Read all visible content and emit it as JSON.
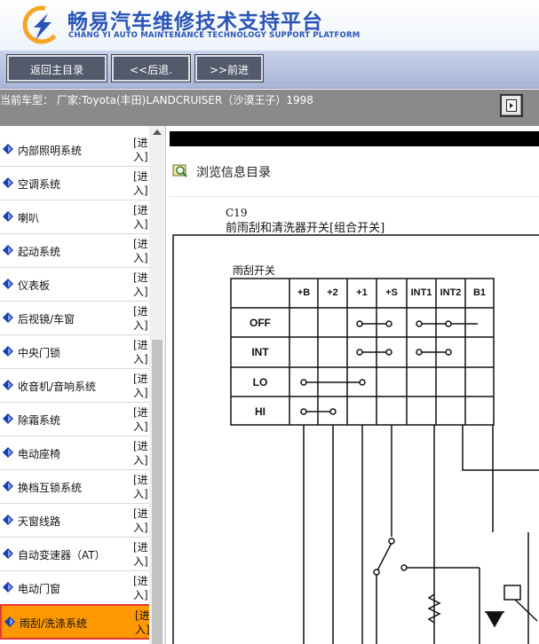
{
  "header": {
    "title_cn": "畅易汽车维修技术支持平台",
    "title_en": "CHANG YI AUTO MAINTENANCE TECHNOLOGY SUPPORT PLATFORM",
    "logo_icon": "cy-logo-icon"
  },
  "toolbar": {
    "home_label": "返回主目录",
    "back_label": "<<后退.",
    "forward_label": ">>前进"
  },
  "status": {
    "model_text": "当前车型： 厂家:Toyota(丰田)LANDCRUISER（沙漠王子）1998"
  },
  "sidebar": {
    "enter_label": "[进入]",
    "items": [
      {
        "label": "内部照明系统"
      },
      {
        "label": "空调系统"
      },
      {
        "label": "喇叭"
      },
      {
        "label": "起动系统"
      },
      {
        "label": "仪表板"
      },
      {
        "label": "后视镜/车窗"
      },
      {
        "label": "中央门锁"
      },
      {
        "label": "收音机/音响系统"
      },
      {
        "label": "除霜系统"
      },
      {
        "label": "电动座椅"
      },
      {
        "label": "换档互锁系统"
      },
      {
        "label": "天窗线路"
      },
      {
        "label": "自动变速器（AT）"
      },
      {
        "label": "电动门窗"
      },
      {
        "label": "雨刮/洗涤系统",
        "selected": true
      }
    ],
    "accent_color": "#ff9800",
    "highlight_border": "#e53935"
  },
  "main": {
    "browse_title": "浏览信息目录",
    "diagram": {
      "code": "C19",
      "switch_name": "前雨刮和清洗器开关[组合开关]",
      "wiper_label": "雨刮开关",
      "columns": [
        "+B",
        "+2",
        "+1",
        "+S",
        "INT1",
        "INT2",
        "B1"
      ],
      "rows": [
        "OFF",
        "INT",
        "LO",
        "HI"
      ]
    }
  }
}
